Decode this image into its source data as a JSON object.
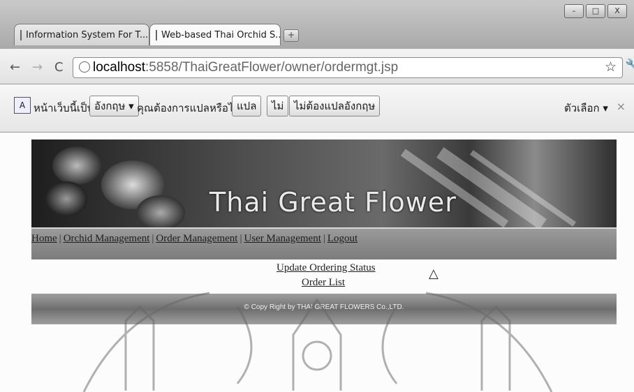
{
  "window": {
    "minimize": "–",
    "maximize": "□",
    "close": "X"
  },
  "tabs": [
    {
      "title": "Information System For T...",
      "close": "×"
    },
    {
      "title": "Web-based Thai Orchid S...",
      "close": "×"
    }
  ],
  "new_tab": "+",
  "toolbar": {
    "back": "←",
    "forward": "→",
    "reload": "C",
    "url_host": "localhost",
    "url_path": ":5858/ThaiGreatFlower/owner/ordermgt.jsp",
    "star": "☆",
    "wrench": "🔧"
  },
  "translate_bar": {
    "icon_label": "A",
    "page_is_in": "หน้าเว็บนี้เป็น",
    "language": "อังกฤษ ▾",
    "question": "คุณต้องการแปลหรือไม่",
    "translate": "แปล",
    "no": "ไม่",
    "never": "ไม่ต้องแปลอังกฤษ",
    "options": "ตัวเลือก ▾",
    "close": "×"
  },
  "site": {
    "title": "Thai Great Flower",
    "nav": [
      "Home",
      "Orchid Management",
      "Order Management",
      "User Management",
      "Logout"
    ],
    "nav_separator": "|",
    "links": [
      "Update Ordering Status",
      "Order List"
    ],
    "footer": "© Copy Right by THAI GREAT FLOWERS Co.,LTD."
  },
  "colors": {
    "banner_dark": "#1e1e1e",
    "navbar": "#8a8a8a",
    "footer": "#8f8f8f"
  }
}
